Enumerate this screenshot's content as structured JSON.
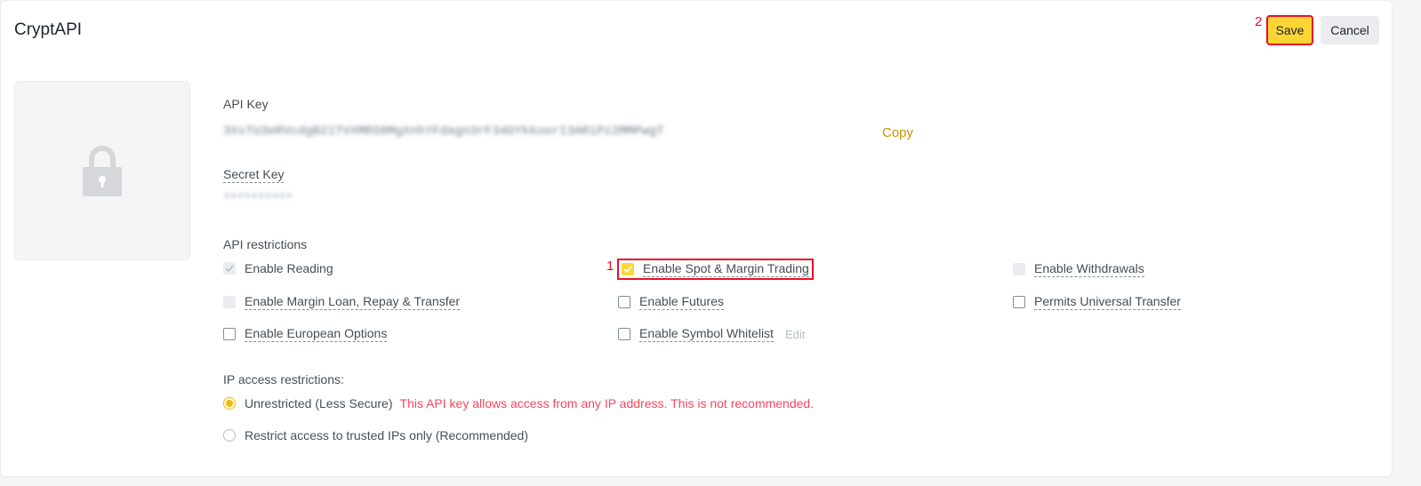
{
  "header": {
    "title": "CryptAPI",
    "save_label": "Save",
    "cancel_label": "Cancel",
    "save_annotation": "2"
  },
  "api_key": {
    "label": "API Key",
    "value": "3XsTU3eRVcdgB21TVXMRS0MgXnhYFdagn3rF34DYkkoorI3ARiPz2MMPwgT",
    "copy_label": "Copy"
  },
  "secret_key": {
    "label": "Secret Key",
    "value": "**********"
  },
  "restrictions": {
    "label": "API restrictions",
    "annotation": "1",
    "items": [
      {
        "label": "Enable Reading",
        "checked": true,
        "disabled": true
      },
      {
        "label": "Enable Spot & Margin Trading",
        "checked": true,
        "disabled": false
      },
      {
        "label": "Enable Withdrawals",
        "checked": false,
        "disabled": true
      },
      {
        "label": "Enable Margin Loan, Repay & Transfer",
        "checked": false,
        "disabled": true
      },
      {
        "label": "Enable Futures",
        "checked": false,
        "disabled": false
      },
      {
        "label": "Permits Universal Transfer",
        "checked": false,
        "disabled": false
      },
      {
        "label": "Enable European Options",
        "checked": false,
        "disabled": false
      },
      {
        "label": "Enable Symbol Whitelist",
        "checked": false,
        "disabled": false,
        "edit_label": "Edit"
      }
    ]
  },
  "ip": {
    "label": "IP access restrictions:",
    "options": [
      {
        "label": "Unrestricted (Less Secure)",
        "selected": true,
        "warning": "This API key allows access from any IP address. This is not recommended."
      },
      {
        "label": "Restrict access to trusted IPs only (Recommended)",
        "selected": false
      }
    ]
  },
  "icons": {
    "thumbnail": "lock-icon",
    "check": "checkmark-icon"
  },
  "colors": {
    "accent": "#fcd535",
    "link": "#c99400",
    "warning": "#f6465d",
    "annotation": "#e8102a"
  }
}
